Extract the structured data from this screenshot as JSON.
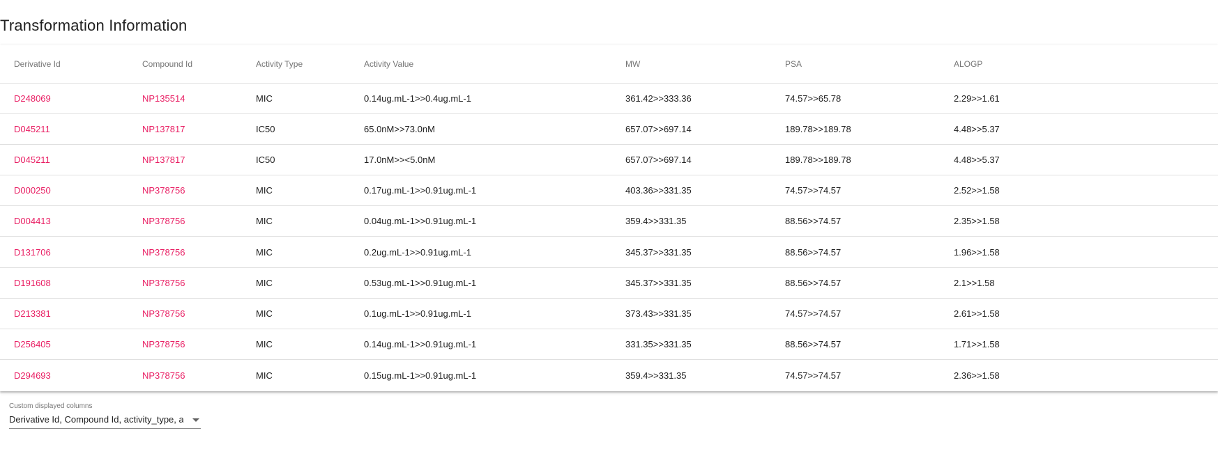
{
  "page": {
    "title": "Transformation Information"
  },
  "table": {
    "columns": [
      "Derivative Id",
      "Compound Id",
      "Activity Type",
      "Activity Value",
      "MW",
      "PSA",
      "ALOGP"
    ],
    "rows": [
      [
        "D248069",
        "NP135514",
        "MIC",
        "0.14ug.mL-1>>0.4ug.mL-1",
        "361.42>>333.36",
        "74.57>>65.78",
        "2.29>>1.61"
      ],
      [
        "D045211",
        "NP137817",
        "IC50",
        "65.0nM>>73.0nM",
        "657.07>>697.14",
        "189.78>>189.78",
        "4.48>>5.37"
      ],
      [
        "D045211",
        "NP137817",
        "IC50",
        "17.0nM>><5.0nM",
        "657.07>>697.14",
        "189.78>>189.78",
        "4.48>>5.37"
      ],
      [
        "D000250",
        "NP378756",
        "MIC",
        "0.17ug.mL-1>>0.91ug.mL-1",
        "403.36>>331.35",
        "74.57>>74.57",
        "2.52>>1.58"
      ],
      [
        "D004413",
        "NP378756",
        "MIC",
        "0.04ug.mL-1>>0.91ug.mL-1",
        "359.4>>331.35",
        "88.56>>74.57",
        "2.35>>1.58"
      ],
      [
        "D131706",
        "NP378756",
        "MIC",
        "0.2ug.mL-1>>0.91ug.mL-1",
        "345.37>>331.35",
        "88.56>>74.57",
        "1.96>>1.58"
      ],
      [
        "D191608",
        "NP378756",
        "MIC",
        "0.53ug.mL-1>>0.91ug.mL-1",
        "345.37>>331.35",
        "88.56>>74.57",
        "2.1>>1.58"
      ],
      [
        "D213381",
        "NP378756",
        "MIC",
        "0.1ug.mL-1>>0.91ug.mL-1",
        "373.43>>331.35",
        "74.57>>74.57",
        "2.61>>1.58"
      ],
      [
        "D256405",
        "NP378756",
        "MIC",
        "0.14ug.mL-1>>0.91ug.mL-1",
        "331.35>>331.35",
        "88.56>>74.57",
        "1.71>>1.58"
      ],
      [
        "D294693",
        "NP378756",
        "MIC",
        "0.15ug.mL-1>>0.91ug.mL-1",
        "359.4>>331.35",
        "74.57>>74.57",
        "2.36>>1.58"
      ]
    ]
  },
  "column_selector": {
    "label": "Custom displayed columns",
    "value": "Derivative Id, Compound Id, activity_type, a...",
    "icon": "caret-down-icon"
  },
  "colors": {
    "link": "#e91e63",
    "text": "#212121",
    "header_text": "#757575",
    "divider": "#e0e0e0"
  }
}
